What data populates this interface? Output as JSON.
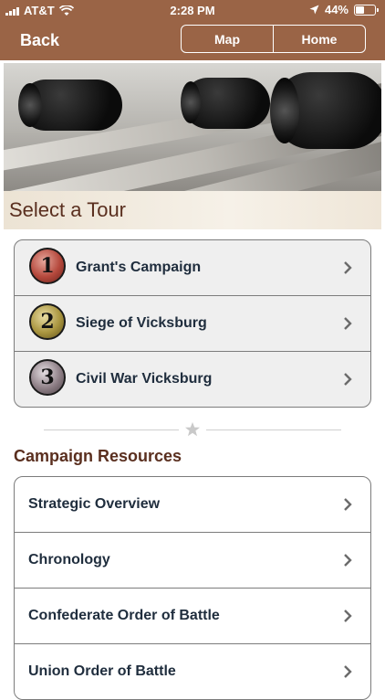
{
  "status": {
    "carrier": "AT&T",
    "time": "2:28 PM",
    "battery": "44%",
    "battery_level": 0.44
  },
  "nav": {
    "back_label": "Back",
    "map_label": "Map",
    "home_label": "Home"
  },
  "section_title": "Select a Tour",
  "tours": [
    {
      "number": "1",
      "label": "Grant's Campaign",
      "color": "#b5483c"
    },
    {
      "number": "2",
      "label": "Siege of Vicksburg",
      "color": "#a9953f"
    },
    {
      "number": "3",
      "label": "Civil War Vicksburg",
      "color": "#8e7f86"
    }
  ],
  "resources": {
    "title": "Campaign Resources",
    "items": [
      "Strategic Overview",
      "Chronology",
      "Confederate Order of Battle",
      "Union Order of Battle"
    ]
  },
  "colors": {
    "header_bg": "#9a6446",
    "title_text": "#5a2f1f",
    "item_text": "#1f2d3d",
    "chevron": "#6b6b6b"
  }
}
